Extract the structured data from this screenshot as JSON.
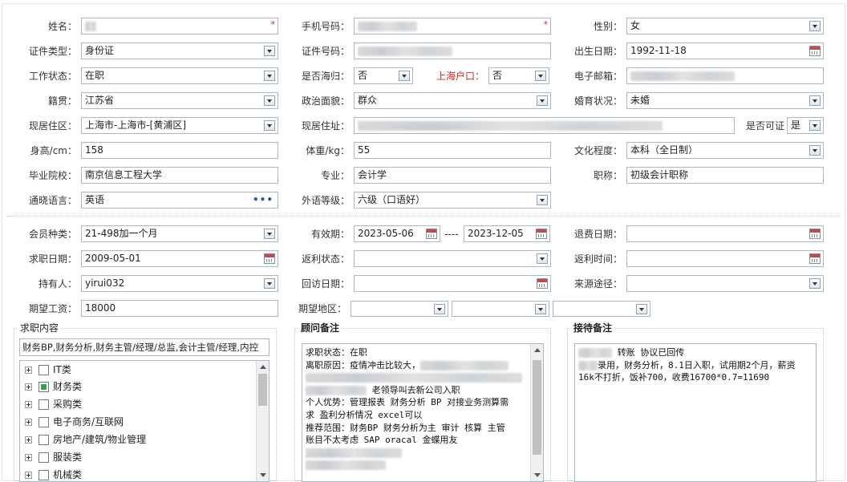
{
  "form": {
    "name": {
      "label": "姓名：",
      "value": ""
    },
    "phone": {
      "label": "手机号码：",
      "value": ""
    },
    "gender": {
      "label": "性别：",
      "value": "女"
    },
    "id_type": {
      "label": "证件类型：",
      "value": "身份证"
    },
    "id_number": {
      "label": "证件号码：",
      "value": ""
    },
    "birthdate": {
      "label": "出生日期：",
      "value": "1992-11-18"
    },
    "work_status": {
      "label": "工作状态：",
      "value": "在职"
    },
    "returnee": {
      "label": "是否海归：",
      "value": "否"
    },
    "sh_hukou": {
      "label": "上海户口：",
      "value": "否"
    },
    "email": {
      "label": "电子邮箱：",
      "value": ""
    },
    "native_place": {
      "label": "籍贯：",
      "value": "江苏省"
    },
    "political": {
      "label": "政治面貌：",
      "value": "群众"
    },
    "marital": {
      "label": "婚育状况：",
      "value": "未婚"
    },
    "current_area": {
      "label": "现居住区：",
      "value": "上海市-上海市-[黄浦区]"
    },
    "current_address": {
      "label": "现居住址：",
      "value": ""
    },
    "can_verify": {
      "label": "是否可证",
      "value": "是"
    },
    "height": {
      "label": "身高/cm：",
      "value": "158"
    },
    "weight": {
      "label": "体重/kg：",
      "value": "55"
    },
    "education": {
      "label": "文化程度：",
      "value": "本科（全日制）"
    },
    "school": {
      "label": "毕业院校：",
      "value": "南京信息工程大学"
    },
    "major": {
      "label": "专业：",
      "value": "会计学"
    },
    "title": {
      "label": "职称：",
      "value": "初级会计职称"
    },
    "language": {
      "label": "通晓语言：",
      "value": "英语"
    },
    "foreign_level": {
      "label": "外语等级：",
      "value": "六级（口语好）"
    },
    "member_type": {
      "label": "会员种类：",
      "value": "21-498加一个月"
    },
    "valid_period": {
      "label": "有效期：",
      "start": "2023-05-06",
      "separator": "----",
      "end": "2023-12-05"
    },
    "refund_date": {
      "label": "退费日期：",
      "value": ""
    },
    "job_date": {
      "label": "求职日期：",
      "value": "2009-05-01"
    },
    "rebate_status": {
      "label": "返利状态：",
      "value": ""
    },
    "rebate_time": {
      "label": "返利时间：",
      "value": ""
    },
    "holder": {
      "label": "持有人：",
      "value": "yirui032"
    },
    "visit_date": {
      "label": "回访日期：",
      "value": ""
    },
    "source": {
      "label": "来源途径：",
      "value": ""
    },
    "expected_salary": {
      "label": "期望工资：",
      "value": "18000"
    },
    "expected_region": {
      "label": "期望地区：",
      "v1": "",
      "v2": "",
      "v3": ""
    }
  },
  "job_content": {
    "title": "求职内容",
    "summary": "财务BP,财务分析,财务主管/经理/总监,会计主管/经理,内控",
    "tree": [
      {
        "label": "IT类",
        "checked": false
      },
      {
        "label": "财务类",
        "checked": true
      },
      {
        "label": "采购类",
        "checked": false
      },
      {
        "label": "电子商务/互联网",
        "checked": false
      },
      {
        "label": "房地产/建筑/物业管理",
        "checked": false
      },
      {
        "label": "服装类",
        "checked": false
      },
      {
        "label": "机械类",
        "checked": false
      }
    ]
  },
  "consultant_notes": {
    "title": "顾问备注",
    "lines": [
      "求职状态：在职",
      "离职原因：疫情冲击比较大，",
      "",
      " 老领导叫去新公司入职",
      "个人优势：管理报表 财务分析 BP 对接业务测算需",
      "求 盈利分析情况 excel可以",
      "推荐范围：财务BP 财务分析为主 审计 核算 主管",
      "账目不太考虑  SAP oracal 金蝶用友",
      "",
      ""
    ]
  },
  "reception_notes": {
    "title": "接待备注",
    "lines": [
      " 转账  协议已回传",
      "",
      "",
      "录用，财务分析，8.1日入职，试用期2个月，薪资",
      "16k不打折，饭补700，收费16700*0.7=11690"
    ]
  }
}
